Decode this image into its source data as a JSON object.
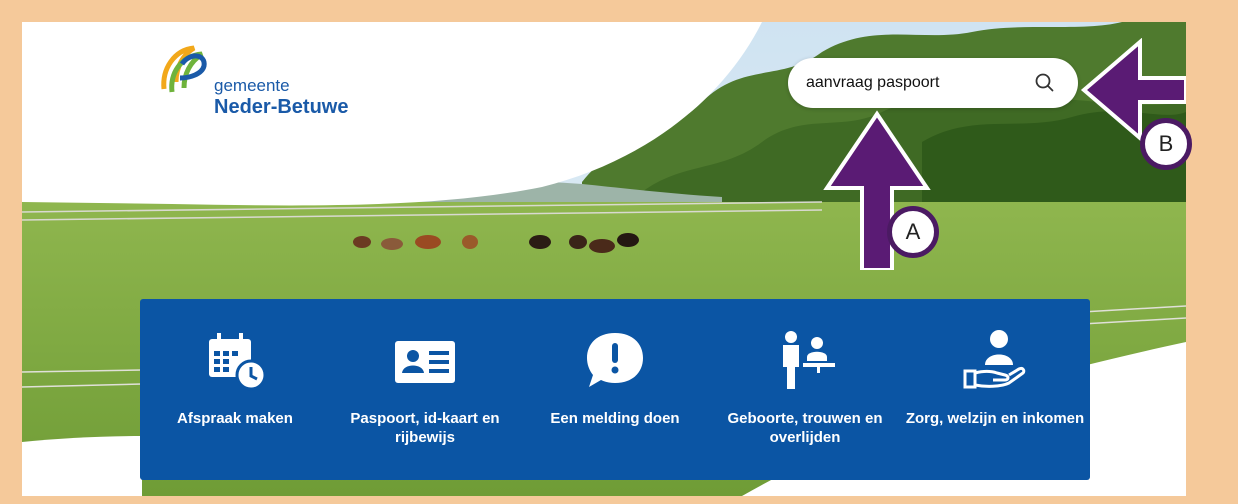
{
  "logo": {
    "line1": "gemeente",
    "line2": "Neder-Betuwe"
  },
  "search": {
    "value": "aanvraag paspoort",
    "icon": "search-icon"
  },
  "tiles": [
    {
      "label": "Afspraak maken",
      "icon": "calendar-clock-icon"
    },
    {
      "label": "Paspoort, id-kaart en rijbewijs",
      "icon": "id-card-icon"
    },
    {
      "label": "Een melding doen",
      "icon": "exclamation-speech-icon"
    },
    {
      "label": "Geboorte, trouwen en overlijden",
      "icon": "people-desk-icon"
    },
    {
      "label": "Zorg, welzijn en inkomen",
      "icon": "hand-person-icon"
    }
  ],
  "annotations": {
    "a": "A",
    "b": "B",
    "color": "#5a1b74"
  },
  "colors": {
    "brand_blue": "#0b55a4",
    "frame": "#f5c99a"
  }
}
